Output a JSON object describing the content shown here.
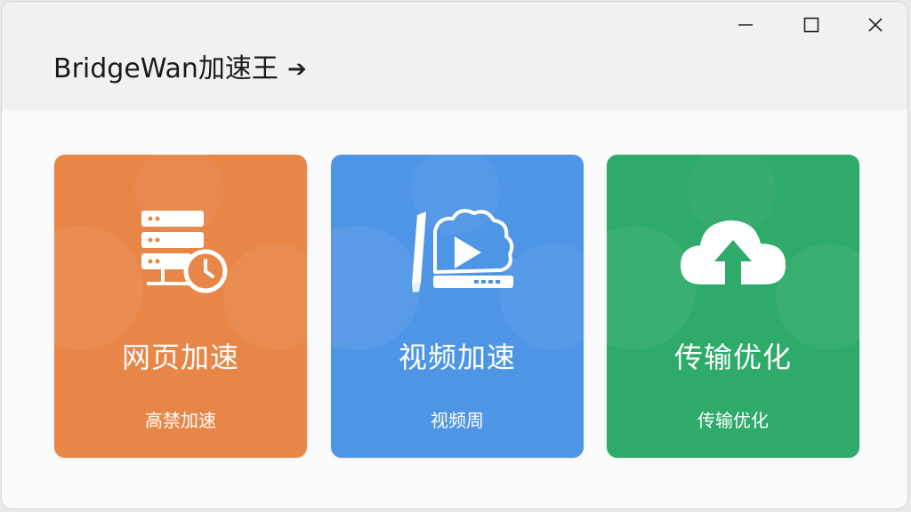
{
  "window": {
    "title": "BridgeWan加速王",
    "title_arrow": "➔",
    "controls": [
      "minimize",
      "maximize",
      "close"
    ]
  },
  "cards": [
    {
      "id": "web",
      "title": "网页加速",
      "subtitle": "高禁加速",
      "icon": "server-clock-icon",
      "color": "#e88648"
    },
    {
      "id": "video",
      "title": "视频加速",
      "subtitle": "视频周",
      "icon": "video-cloud-icon",
      "color": "#4f95e6"
    },
    {
      "id": "transfer",
      "title": "传输优化",
      "subtitle": "传输优化",
      "icon": "cloud-upload-icon",
      "color": "#2eaa6a"
    }
  ]
}
